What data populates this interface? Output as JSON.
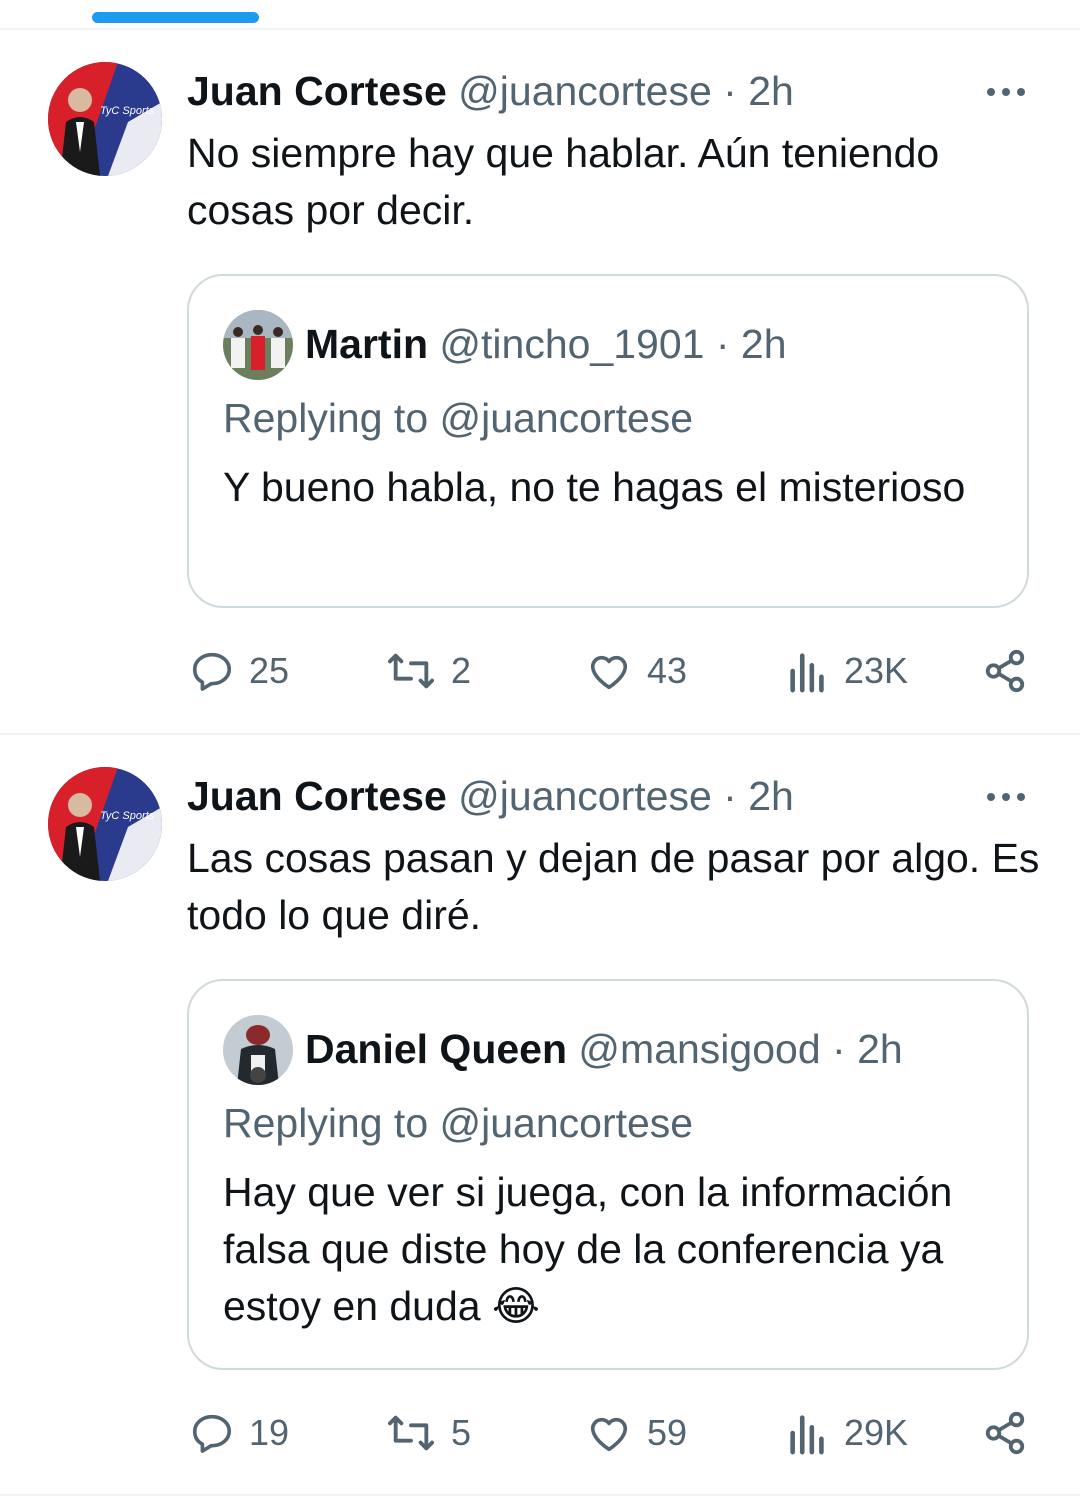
{
  "tweets": [
    {
      "author_name": "Juan Cortese",
      "author_handle": "@juancortese",
      "dot": "·",
      "time": "2h",
      "avatar_text": "TyC Sports",
      "text": "No siempre hay que hablar. Aún teniendo cosas por decir.",
      "quote": {
        "author_name": "Martin",
        "author_handle": "@tincho_1901",
        "dot": "·",
        "time": "2h",
        "replying_to": "Replying to @juancortese",
        "text": "Y bueno habla, no te hagas el misterioso"
      },
      "stats": {
        "replies": "25",
        "retweets": "2",
        "likes": "43",
        "views": "23K"
      }
    },
    {
      "author_name": "Juan Cortese",
      "author_handle": "@juancortese",
      "dot": "·",
      "time": "2h",
      "avatar_text": "TyC Sports",
      "text": "Las cosas pasan y dejan de pasar por algo. Es todo lo que diré.",
      "quote": {
        "author_name": "Daniel Queen",
        "author_handle": "@mansigood",
        "dot": "·",
        "time": "2h",
        "replying_to": "Replying to @juancortese",
        "text": "Hay que ver si juega, con la información falsa que diste hoy de la conferencia ya estoy en duda 😂"
      },
      "stats": {
        "replies": "19",
        "retweets": "5",
        "likes": "59",
        "views": "29K"
      }
    }
  ],
  "colors": {
    "accent": "#1d9bf0",
    "text_primary": "#0f1419",
    "text_secondary": "#536471",
    "border": "#cfd9de",
    "divider": "#eff3f4"
  },
  "icons": [
    "more-icon",
    "reply-icon",
    "retweet-icon",
    "like-icon",
    "views-icon",
    "share-icon"
  ]
}
